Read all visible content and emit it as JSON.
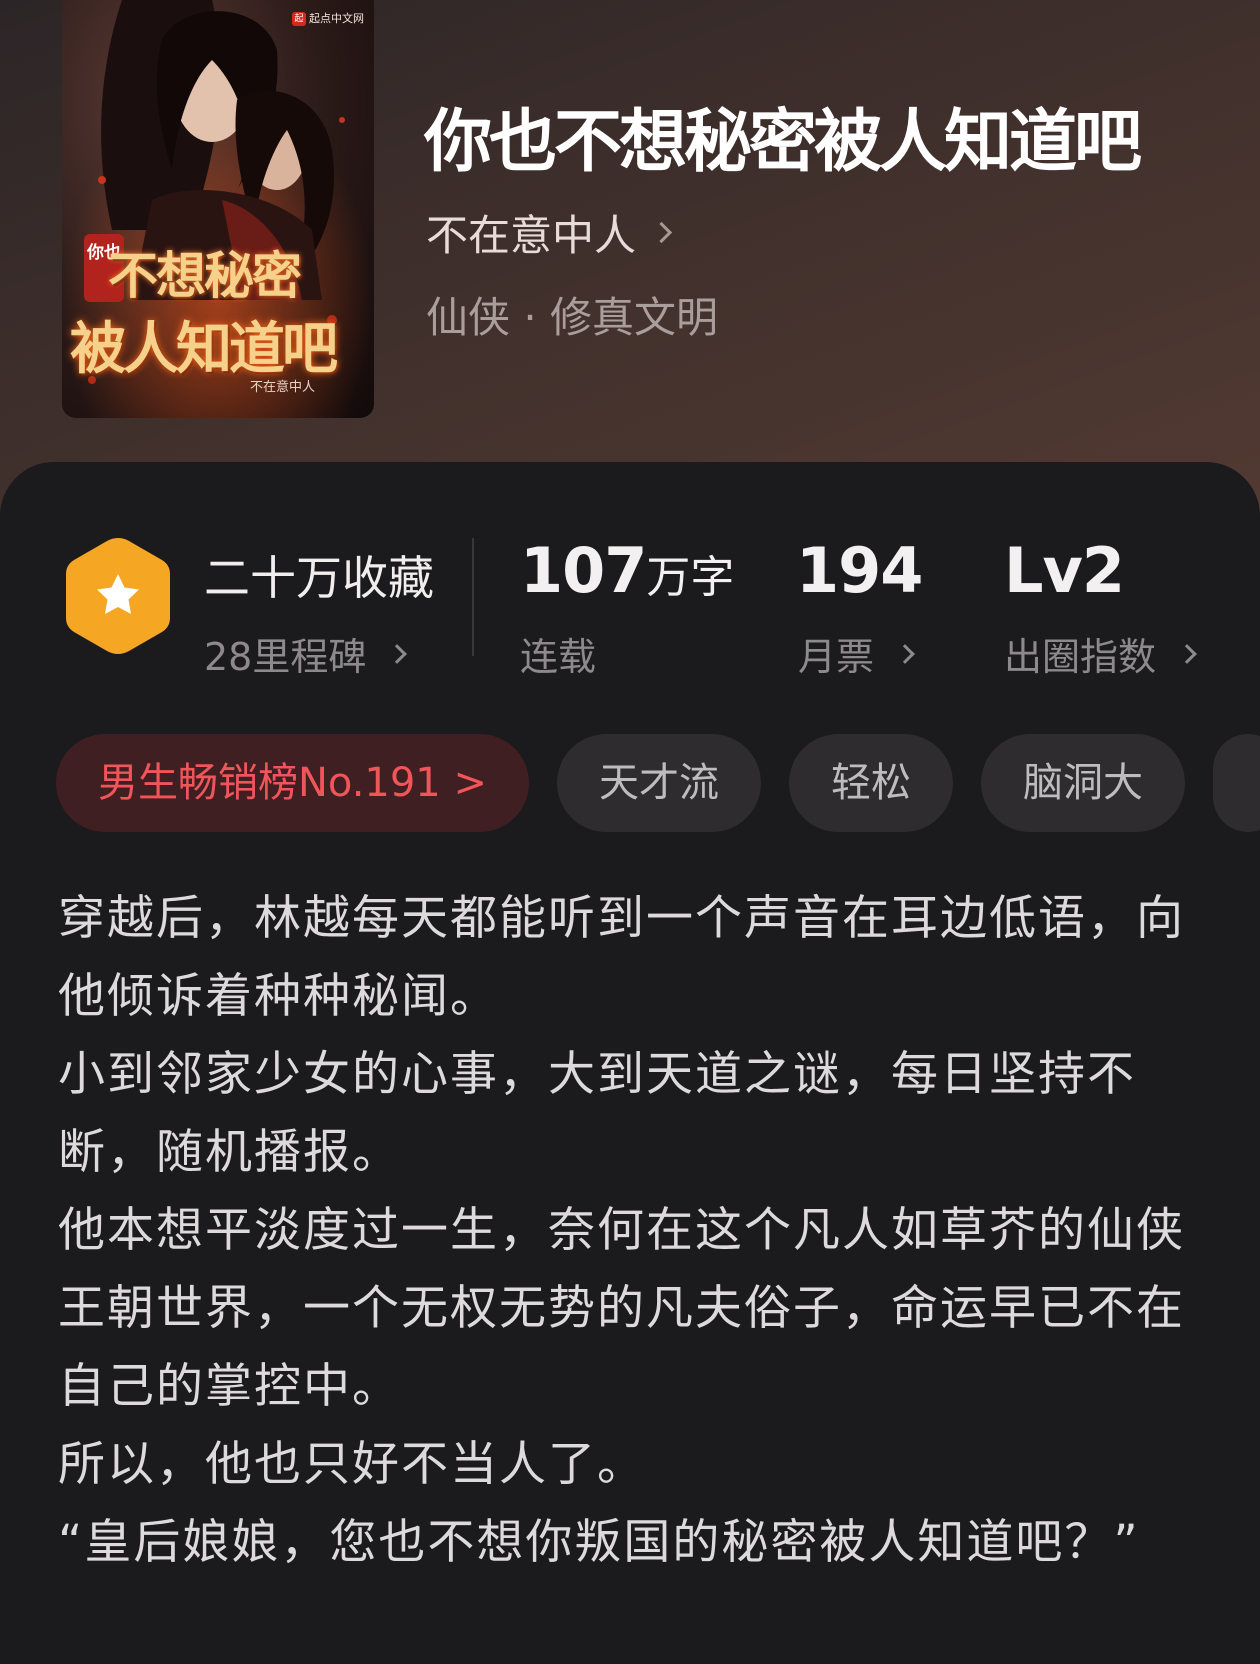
{
  "cover": {
    "publisher": "起点中文网",
    "publisher_logo": "起",
    "seal_text": "你也",
    "title_line1": "不想秘密",
    "title_line2": "被人知道吧",
    "author": "不在意中人"
  },
  "book": {
    "title": "你也不想秘密被人知道吧",
    "author": "不在意中人",
    "genre": "仙侠 · 修真文明"
  },
  "stats": {
    "collect_title": "二十万收藏",
    "collect_sub": "28里程碑",
    "words_value": "107",
    "words_unit": "万字",
    "words_sub": "连载",
    "votes_value": "194",
    "votes_sub": "月票",
    "index_value": "Lv2",
    "index_sub": "出圈指数"
  },
  "tags": {
    "rank": "男生畅销榜No.191 >",
    "items": [
      "天才流",
      "轻松",
      "脑洞大"
    ]
  },
  "synopsis": [
    "穿越后，林越每天都能听到一个声音在耳边低语，向他倾诉着种种秘闻。",
    "小到邻家少女的心事，大到天道之谜，每日坚持不断，随机播报。",
    "他本想平淡度过一生，奈何在这个凡人如草芥的仙侠王朝世界，一个无权无势的凡夫俗子，命运早已不在自己的掌控中。",
    "所以，他也只好不当人了。",
    "“皇后娘娘，您也不想你叛国的秘密被人知道吧？”"
  ],
  "colors": {
    "accent_red": "#f0555a",
    "rank_bg": "#3f1f22",
    "badge_orange": "#f5a623",
    "card_bg": "#1b1a1c"
  }
}
